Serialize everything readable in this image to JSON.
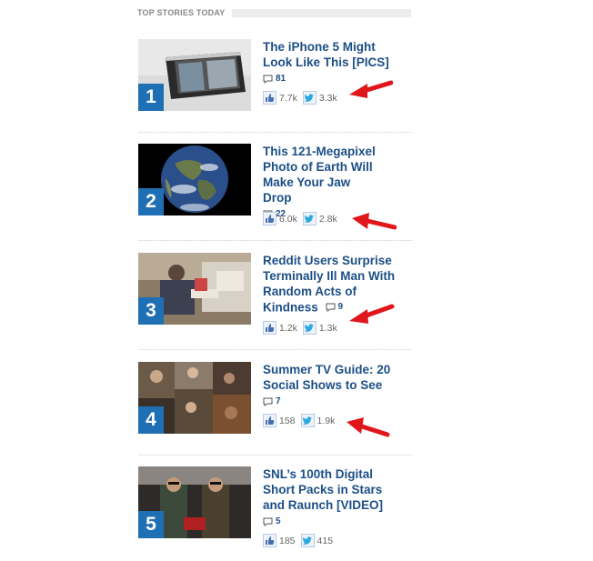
{
  "section_title": "TOP STORIES TODAY",
  "stories": [
    {
      "rank": "1",
      "title": "The iPhone 5 Might Look Like This [PICS]",
      "comments": "81",
      "likes": "7.7k",
      "tweets": "3.3k"
    },
    {
      "rank": "2",
      "title": "This 121-Megapixel Photo of Earth Will Make Your Jaw Drop",
      "comments": "22",
      "likes": "6.0k",
      "tweets": "2.8k"
    },
    {
      "rank": "3",
      "title": "Reddit Users Surprise Terminally Ill Man With Random Acts of Kindness",
      "comments": "9",
      "likes": "1.2k",
      "tweets": "1.3k"
    },
    {
      "rank": "4",
      "title": "Summer TV Guide: 20 Social Shows to See",
      "comments": "7",
      "likes": "158",
      "tweets": "1.9k"
    },
    {
      "rank": "5",
      "title": "SNL’s 100th Digital Short Packs in Stars and Raunch [VIDEO]",
      "comments": "5",
      "likes": "185",
      "tweets": "415"
    }
  ],
  "colors": {
    "rank_badge": "#1f6fb5",
    "title_link": "#1c4f86",
    "annotation_arrow": "#e0161b"
  },
  "icons": {
    "comment": "speech-bubble-icon",
    "like": "facebook-like-icon",
    "tweet": "twitter-bird-icon",
    "annotation": "red-arrow-icon"
  }
}
